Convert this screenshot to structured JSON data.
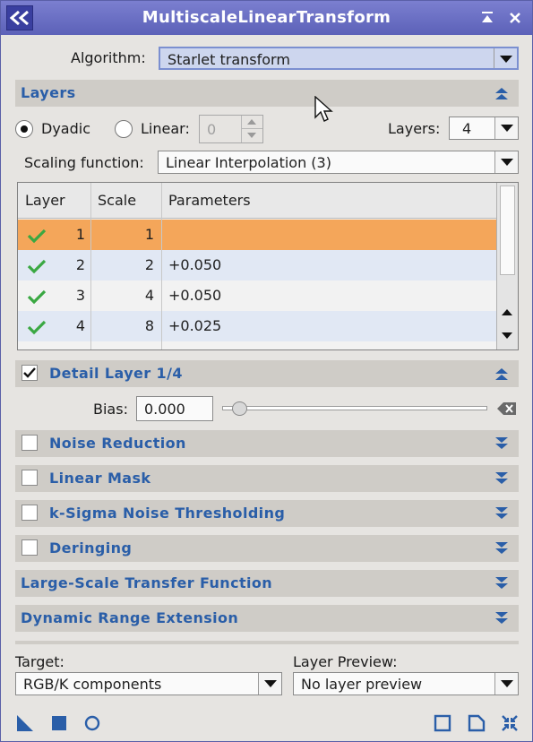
{
  "window": {
    "title": "MultiscaleLinearTransform"
  },
  "algorithm": {
    "label": "Algorithm:",
    "value": "Starlet transform"
  },
  "layers_section": {
    "title": "Layers",
    "dyadic_label": "Dyadic",
    "linear_label": "Linear:",
    "linear_value": "0",
    "layers_label": "Layers:",
    "layers_value": "4",
    "scaling_label": "Scaling function:",
    "scaling_value": "Linear Interpolation (3)"
  },
  "table": {
    "headers": [
      "Layer",
      "Scale",
      "Parameters"
    ],
    "rows": [
      {
        "layer": "1",
        "scale": "1",
        "params": ""
      },
      {
        "layer": "2",
        "scale": "2",
        "params": "+0.050"
      },
      {
        "layer": "3",
        "scale": "4",
        "params": "+0.050"
      },
      {
        "layer": "4",
        "scale": "8",
        "params": "+0.025"
      }
    ]
  },
  "detail": {
    "title": "Detail Layer 1/4",
    "bias_label": "Bias:",
    "bias_value": "0.000",
    "bias_slider": 0.0
  },
  "sections": {
    "noise": "Noise Reduction",
    "mask": "Linear Mask",
    "ksigma": "k-Sigma Noise Thresholding",
    "deringing": "Deringing",
    "lstf": "Large-Scale Transfer Function",
    "dre": "Dynamic Range Extension"
  },
  "target": {
    "label": "Target:",
    "value": "RGB/K components"
  },
  "preview": {
    "label": "Layer Preview:",
    "value": "No layer preview"
  },
  "colors": {
    "accent": "#2a5ea8",
    "selected_row": "#f4a65a",
    "check": "#3aa842",
    "titlebar": "#6468c0"
  }
}
